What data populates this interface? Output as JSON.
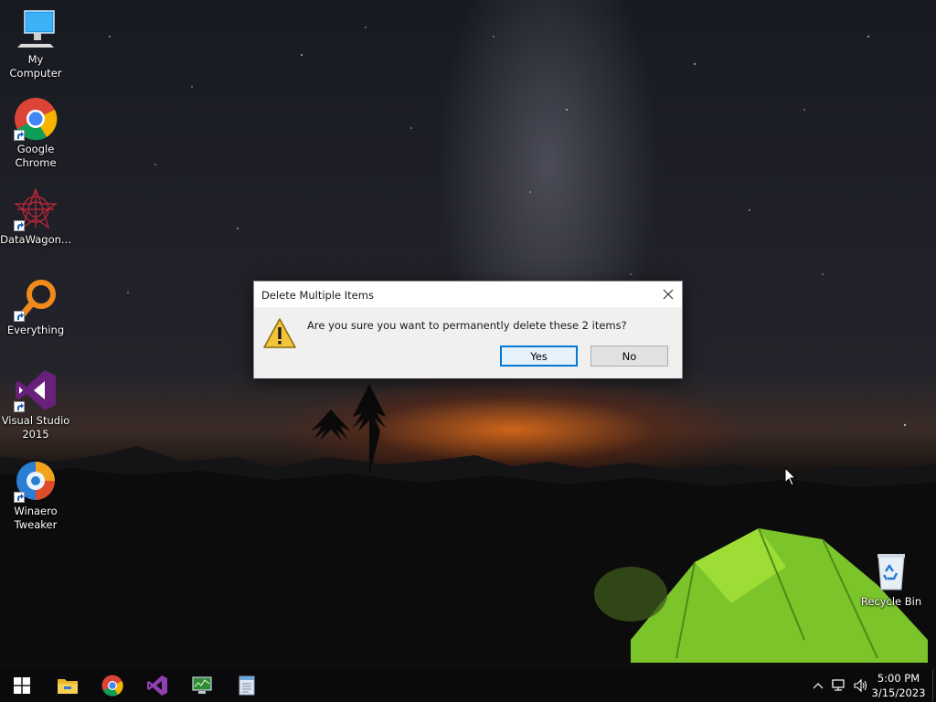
{
  "desktop": {
    "icons": [
      {
        "label": "My Computer",
        "icon": "computer-icon"
      },
      {
        "label": "Google Chrome",
        "icon": "chrome-icon"
      },
      {
        "label": "DataWagon...",
        "icon": "datawagon-icon"
      },
      {
        "label": "Everything",
        "icon": "everything-search-icon"
      },
      {
        "label": "Visual Studio 2015",
        "icon": "visual-studio-icon"
      },
      {
        "label": "Winaero Tweaker",
        "icon": "winaero-tweaker-icon"
      },
      {
        "label": "Recycle Bin",
        "icon": "recycle-bin-icon"
      }
    ]
  },
  "dialog": {
    "title": "Delete Multiple Items",
    "message": "Are you sure you want to permanently delete these 2 items?",
    "yes_label": "Yes",
    "no_label": "No",
    "icon": "warning-icon"
  },
  "taskbar": {
    "items": [
      {
        "icon": "start-windows-icon"
      },
      {
        "icon": "file-explorer-icon"
      },
      {
        "icon": "chrome-icon"
      },
      {
        "icon": "visual-studio-icon"
      },
      {
        "icon": "system-monitor-icon"
      },
      {
        "icon": "notepad-document-icon"
      }
    ],
    "clock": {
      "time": "5:00 PM",
      "date": "3/15/2023"
    }
  },
  "colors": {
    "accent": "#0078d7",
    "dialog_bg": "#f0f0f0",
    "taskbar_bg": "#0a0a0c"
  }
}
